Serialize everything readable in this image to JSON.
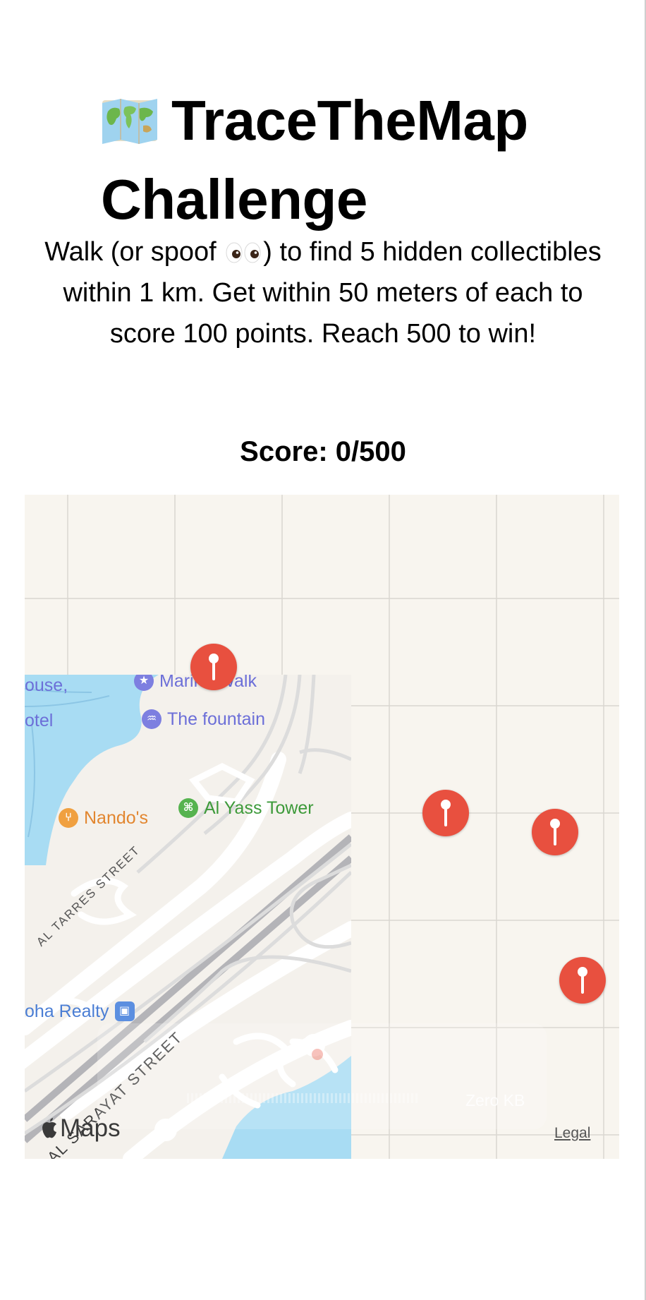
{
  "header": {
    "title": "TraceTheMap Challenge",
    "title_icon": "world-map-emoji"
  },
  "intro": {
    "before_emoji": "Walk (or spoof ",
    "emoji": "eyes-emoji",
    "after_emoji": ") to find 5 hidden collectibles within 1 km. Get within 50 meters of each to score 100 points. Reach 500 to win!"
  },
  "score": {
    "label": "Score: 0/500",
    "current": 0,
    "target": 500
  },
  "map": {
    "pois": {
      "marina_walk": "Marina Walk",
      "fountain": "The fountain",
      "al_yass": "Al Yass Tower",
      "nandos": "Nando's",
      "house": "ouse,",
      "hotel": "otel",
      "realty": "oha Realty"
    },
    "streets": {
      "al_tarres": "AL TARRES STREET",
      "al_sarayat": "AL SARAYAT STREET"
    },
    "collectibles_visible": 4,
    "attribution": "Maps",
    "legal_label": "Legal",
    "overlay_text": "Zero KB",
    "colors": {
      "pin": "#e8503f",
      "water": "#a8dcf3",
      "map_background": "#f8f5ef"
    }
  }
}
